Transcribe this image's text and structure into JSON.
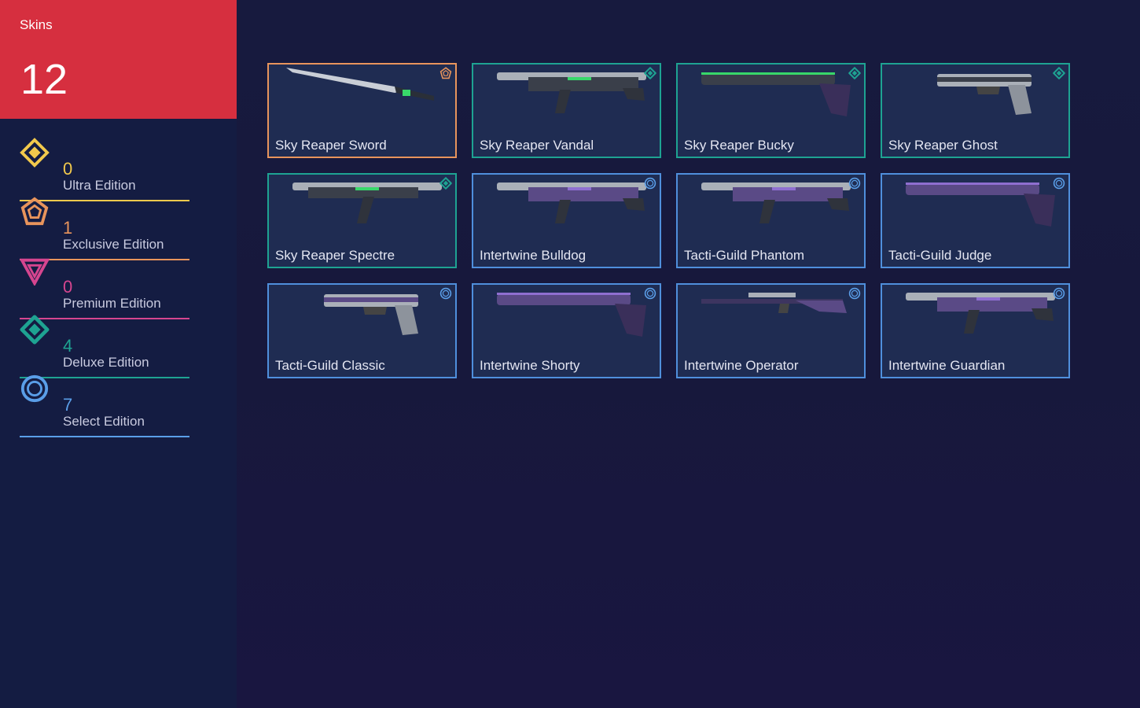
{
  "header": {
    "title": "Skins",
    "count": "12"
  },
  "stats": [
    {
      "count": "0",
      "label": "Ultra Edition",
      "color": "#f2c94c",
      "icon": "ultra-edition-icon"
    },
    {
      "count": "1",
      "label": "Exclusive Edition",
      "color": "#e8945c",
      "icon": "exclusive-edition-icon"
    },
    {
      "count": "0",
      "label": "Premium Edition",
      "color": "#d6458f",
      "icon": "premium-edition-icon"
    },
    {
      "count": "4",
      "label": "Deluxe Edition",
      "color": "#1ea392",
      "icon": "deluxe-edition-icon"
    },
    {
      "count": "7",
      "label": "Select Edition",
      "color": "#5a9ee8",
      "icon": "select-edition-icon"
    }
  ],
  "skins": [
    {
      "name": "Sky Reaper Sword",
      "tier": "exclusive",
      "weapon": "sword-icon"
    },
    {
      "name": "Sky Reaper Vandal",
      "tier": "deluxe",
      "weapon": "rifle-icon"
    },
    {
      "name": "Sky Reaper Bucky",
      "tier": "deluxe",
      "weapon": "shotgun-icon"
    },
    {
      "name": "Sky Reaper Ghost",
      "tier": "deluxe",
      "weapon": "pistol-icon"
    },
    {
      "name": "Sky Reaper Spectre",
      "tier": "deluxe",
      "weapon": "smg-icon"
    },
    {
      "name": "Intertwine Bulldog",
      "tier": "select",
      "weapon": "rifle-icon"
    },
    {
      "name": "Tacti-Guild Phantom",
      "tier": "select",
      "weapon": "rifle-icon"
    },
    {
      "name": "Tacti-Guild Judge",
      "tier": "select",
      "weapon": "shotgun-icon"
    },
    {
      "name": "Tacti-Guild Classic",
      "tier": "select",
      "weapon": "pistol-icon"
    },
    {
      "name": "Intertwine Shorty",
      "tier": "select",
      "weapon": "shotgun-icon"
    },
    {
      "name": "Intertwine Operator",
      "tier": "select",
      "weapon": "sniper-icon"
    },
    {
      "name": "Intertwine Guardian",
      "tier": "select",
      "weapon": "rifle-icon"
    }
  ]
}
